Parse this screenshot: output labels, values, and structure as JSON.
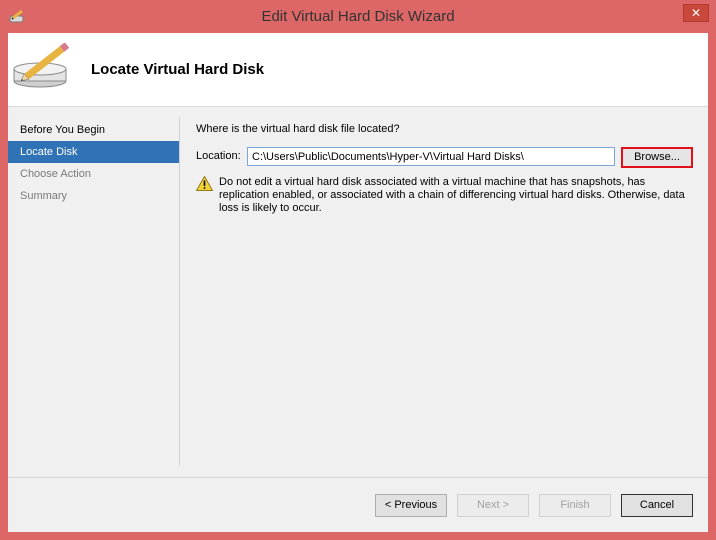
{
  "window": {
    "title": "Edit Virtual Hard Disk Wizard",
    "close_glyph": "✕"
  },
  "header": {
    "title": "Locate Virtual Hard Disk"
  },
  "sidebar": {
    "items": [
      {
        "label": "Before You Begin",
        "state": "normal"
      },
      {
        "label": "Locate Disk",
        "state": "active"
      },
      {
        "label": "Choose Action",
        "state": "disabled"
      },
      {
        "label": "Summary",
        "state": "disabled"
      }
    ]
  },
  "main": {
    "question": "Where is the virtual hard disk file located?",
    "location_label": "Location:",
    "location_value": "C:\\Users\\Public\\Documents\\Hyper-V\\Virtual Hard Disks\\",
    "browse_label": "Browse...",
    "warning": "Do not edit a virtual hard disk associated with a virtual machine that has snapshots, has replication enabled, or associated with a chain of differencing virtual hard disks. Otherwise, data loss is likely to occur."
  },
  "footer": {
    "previous_label": "< Previous",
    "next_label": "Next >",
    "finish_label": "Finish",
    "cancel_label": "Cancel"
  },
  "colors": {
    "frame": "#dd6666",
    "active_nav": "#3072b6",
    "highlight_border": "#e0101a"
  },
  "icons": {
    "app": "disk-pencil-icon",
    "header": "disk-pencil-icon",
    "warning": "warning-icon"
  }
}
